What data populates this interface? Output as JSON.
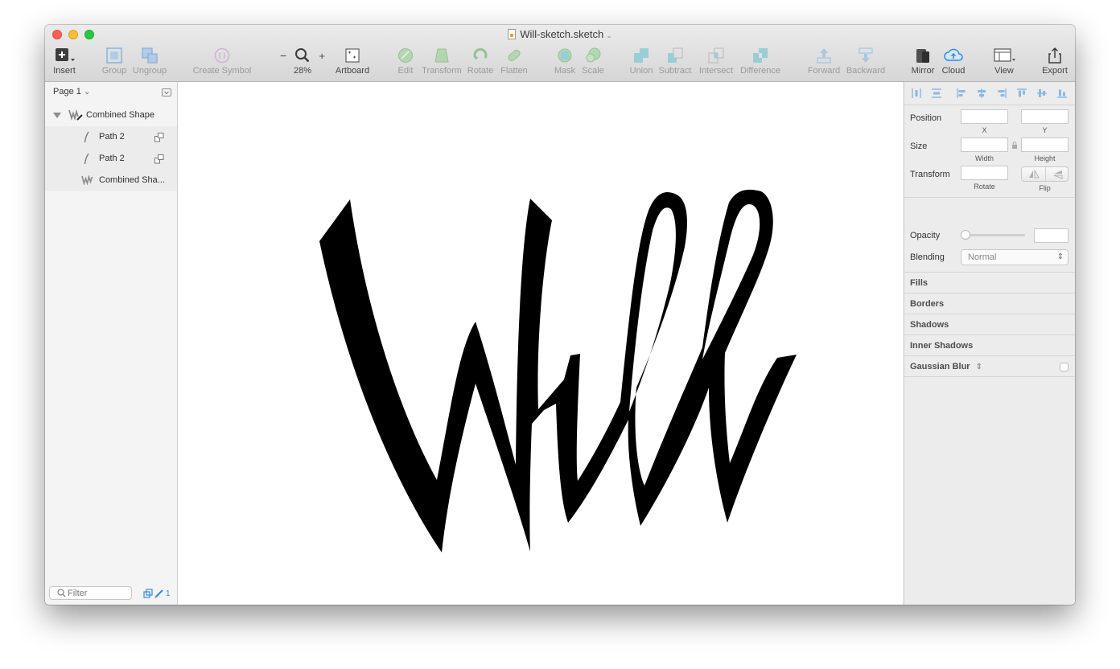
{
  "window": {
    "title": "Will-sketch.sketch"
  },
  "toolbar": {
    "insert": "Insert",
    "group": "Group",
    "ungroup": "Ungroup",
    "create_symbol": "Create Symbol",
    "zoom_minus": "−",
    "zoom_plus": "+",
    "zoom_level": "28%",
    "artboard": "Artboard",
    "edit": "Edit",
    "transform": "Transform",
    "rotate": "Rotate",
    "flatten": "Flatten",
    "mask": "Mask",
    "scale": "Scale",
    "union": "Union",
    "subtract": "Subtract",
    "intersect": "Intersect",
    "difference": "Difference",
    "forward": "Forward",
    "backward": "Backward",
    "mirror": "Mirror",
    "cloud": "Cloud",
    "view": "View",
    "export": "Export"
  },
  "layers": {
    "page": "Page 1",
    "page_chevron": "⌄",
    "items": [
      {
        "name": "Combined Shape"
      },
      {
        "name": "Path 2"
      },
      {
        "name": "Path 2"
      },
      {
        "name": "Combined Sha..."
      }
    ],
    "filter_placeholder": "Filter",
    "slice_count": "1"
  },
  "inspector": {
    "position": "Position",
    "x": "X",
    "y": "Y",
    "size": "Size",
    "width": "Width",
    "height": "Height",
    "transform": "Transform",
    "rotate": "Rotate",
    "flip": "Flip",
    "opacity": "Opacity",
    "blending": "Blending",
    "blending_value": "Normal",
    "fills": "Fills",
    "borders": "Borders",
    "shadows": "Shadows",
    "inner_shadows": "Inner Shadows",
    "gaussian_blur": "Gaussian Blur",
    "opacity_level": 0
  },
  "colors": {
    "accent": "#2f8be6",
    "shape_fill": "#000000",
    "boolean_teal": "#5ec2cf",
    "edit_green": "#8fd18a"
  }
}
